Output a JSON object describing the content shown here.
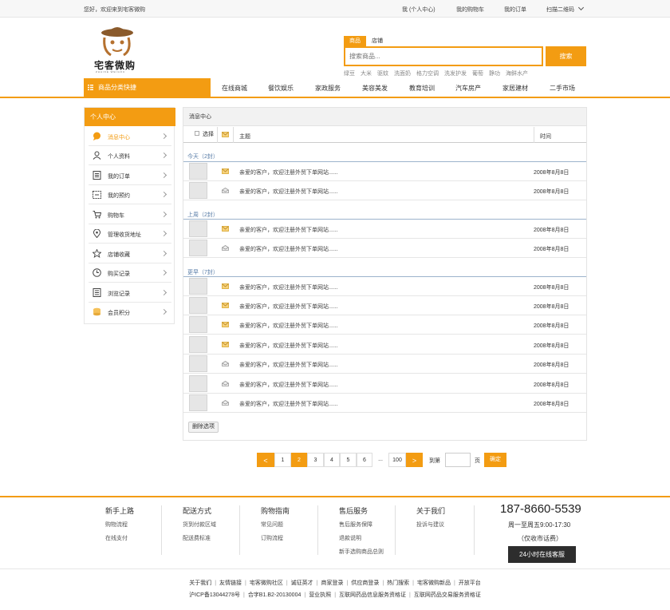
{
  "topbar": {
    "welcome": "您好，欢迎来到宅客微购",
    "links": [
      "我 (个人中心)",
      "我的购物车",
      "我的订单",
      "扫描二维码"
    ]
  },
  "logo": {
    "text": "宅客微购",
    "sub": "ZHAIKE WEIGOU"
  },
  "search": {
    "tabs": [
      "商品",
      "店铺"
    ],
    "placeholder": "搜索商品...",
    "button": "搜索",
    "hot": [
      "绿豆",
      "大米",
      "驱蚊",
      "洗面奶",
      "格力空调",
      "洗发护发",
      "葡萄",
      "静功",
      "海鲜水产"
    ]
  },
  "nav": {
    "category": "商品分类快捷",
    "items": [
      "在线商城",
      "餐饮娱乐",
      "家政服务",
      "美容美发",
      "教育培训",
      "汽车房产",
      "家居建材",
      "二手市场"
    ]
  },
  "sidebar": {
    "title": "个人中心",
    "items": [
      "消息中心",
      "个人资料",
      "我的订单",
      "我的预约",
      "购物车",
      "管理收货地址",
      "店铺收藏",
      "购买记录",
      "浏览记录",
      "会员积分"
    ],
    "active": "消息中心"
  },
  "messages": {
    "title": "消息中心",
    "col_select": "选择",
    "col_subject": "主题",
    "col_time": "时间",
    "groups": [
      {
        "label": "今天（2封）",
        "rows": [
          {
            "unread": true,
            "text": "亲爱的客户，欢迎注册外贸下单网站......",
            "date": "2008年8月8日"
          },
          {
            "unread": false,
            "text": "亲爱的客户，欢迎注册外贸下单网站......",
            "date": "2008年8月8日"
          }
        ]
      },
      {
        "label": "上周（2封）",
        "rows": [
          {
            "unread": true,
            "text": "亲爱的客户，欢迎注册外贸下单网站......",
            "date": "2008年8月8日"
          },
          {
            "unread": false,
            "text": "亲爱的客户，欢迎注册外贸下单网站......",
            "date": "2008年8月8日"
          }
        ]
      },
      {
        "label": "更早（7封）",
        "rows": [
          {
            "unread": true,
            "text": "亲爱的客户，欢迎注册外贸下单网站......",
            "date": "2008年8月8日"
          },
          {
            "unread": true,
            "text": "亲爱的客户，欢迎注册外贸下单网站......",
            "date": "2008年8月8日"
          },
          {
            "unread": true,
            "text": "亲爱的客户，欢迎注册外贸下单网站......",
            "date": "2008年8月8日"
          },
          {
            "unread": true,
            "text": "亲爱的客户，欢迎注册外贸下单网站......",
            "date": "2008年8月8日"
          },
          {
            "unread": false,
            "text": "亲爱的客户，欢迎注册外贸下单网站......",
            "date": "2008年8月8日"
          },
          {
            "unread": false,
            "text": "亲爱的客户，欢迎注册外贸下单网站......",
            "date": "2008年8月8日"
          },
          {
            "unread": false,
            "text": "亲爱的客户，欢迎注册外贸下单网站......",
            "date": "2008年8月8日"
          }
        ]
      }
    ],
    "delete_button": "删除选项"
  },
  "pager": {
    "prev": "<",
    "next": ">",
    "pages": [
      "1",
      "2",
      "3",
      "4",
      "5",
      "6",
      "...",
      "100"
    ],
    "current": "2",
    "goto_prefix": "到第",
    "goto_suffix": "页",
    "confirm": "确定"
  },
  "footer": {
    "columns": [
      {
        "title": "新手上路",
        "links": [
          "购物流程",
          "在线支付"
        ]
      },
      {
        "title": "配送方式",
        "links": [
          "货到付款区域",
          "配送费标准"
        ]
      },
      {
        "title": "购物指南",
        "links": [
          "常见问题",
          "订购流程"
        ]
      },
      {
        "title": "售后服务",
        "links": [
          "售后服务保障",
          "退款说明",
          "新手选购商品总则"
        ]
      },
      {
        "title": "关于我们",
        "links": [
          "投诉与建议"
        ]
      }
    ],
    "phone": "187-8660-5539",
    "hours": "周一至周五9:00-17:30",
    "fee": "（仅收市话费）",
    "service": "24小时在线客服",
    "links1": [
      "关于我们",
      "友情链接",
      "宅客微购社区",
      "诚征英才",
      "商家登录",
      "供应商登录",
      "热门搜索",
      "宅客微购新品",
      "开放平台"
    ],
    "links2": [
      "沪ICP备13044278号",
      "合字B1.B2-20130004",
      "营业执照",
      "互联网药品信息服务资格证",
      "互联网药品交易服务资格证"
    ]
  },
  "colors": {
    "accent": "#f39c12"
  }
}
